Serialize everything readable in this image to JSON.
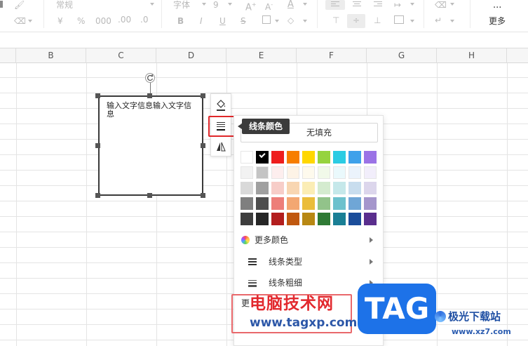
{
  "toolbar": {
    "font_size_dropdown": "常规",
    "currency": "¥",
    "percent": "%",
    "thousands": "000",
    "inc_decimal": ".00",
    "dec_decimal": ".0",
    "font_name": "字体",
    "font_size": "9",
    "bold": "B",
    "italic": "I",
    "underline": "U",
    "strike": "S",
    "more_label": "更多",
    "more_dots": "..."
  },
  "columns": [
    "B",
    "C",
    "D",
    "E",
    "F",
    "G",
    "H"
  ],
  "textbox": {
    "text": "输入文字信息输入文字信息"
  },
  "tooltip": "线条颜色",
  "panel": {
    "no_fill": "无填充",
    "more_colors": "更多颜色",
    "line_type": "线条类型",
    "line_weight": "线条粗细",
    "partial_label": "更",
    "selected_color": "#000000",
    "swatch_rows": [
      [
        "#ffffff",
        "#000000",
        "#ee1e1e",
        "#f77e00",
        "#ffd700",
        "#96d33e",
        "#2bcce3",
        "#3fa1ea",
        "#9b73e6"
      ],
      [
        "#f2f2f2",
        "#c4c4c4",
        "#fdeeee",
        "#fdf3e6",
        "#fefaed",
        "#f1f9e9",
        "#eaf9fc",
        "#ebf3fc",
        "#f2eefb"
      ],
      [
        "#d9d9d9",
        "#a0a0a0",
        "#f7cdc8",
        "#f8d6b2",
        "#fbedb5",
        "#d4ebcf",
        "#c5e8ea",
        "#c8ddee",
        "#dcd6ec"
      ],
      [
        "#7f7f7f",
        "#4e4e4e",
        "#ed7e79",
        "#f3a772",
        "#ebbd3a",
        "#92c38a",
        "#6cc1cd",
        "#6fa6d6",
        "#a596cc"
      ],
      [
        "#3d3d3d",
        "#262626",
        "#b31e1e",
        "#c0580f",
        "#b88813",
        "#2f7a35",
        "#1a7f95",
        "#1b4d9a",
        "#5a2e8d"
      ]
    ]
  },
  "watermark": {
    "site_cn": "电脑技术网",
    "site_url": "www.tagxp.com",
    "tag": "TAG",
    "logo2_cn": "极光下载站",
    "logo2_url": "www.xz7.com"
  }
}
